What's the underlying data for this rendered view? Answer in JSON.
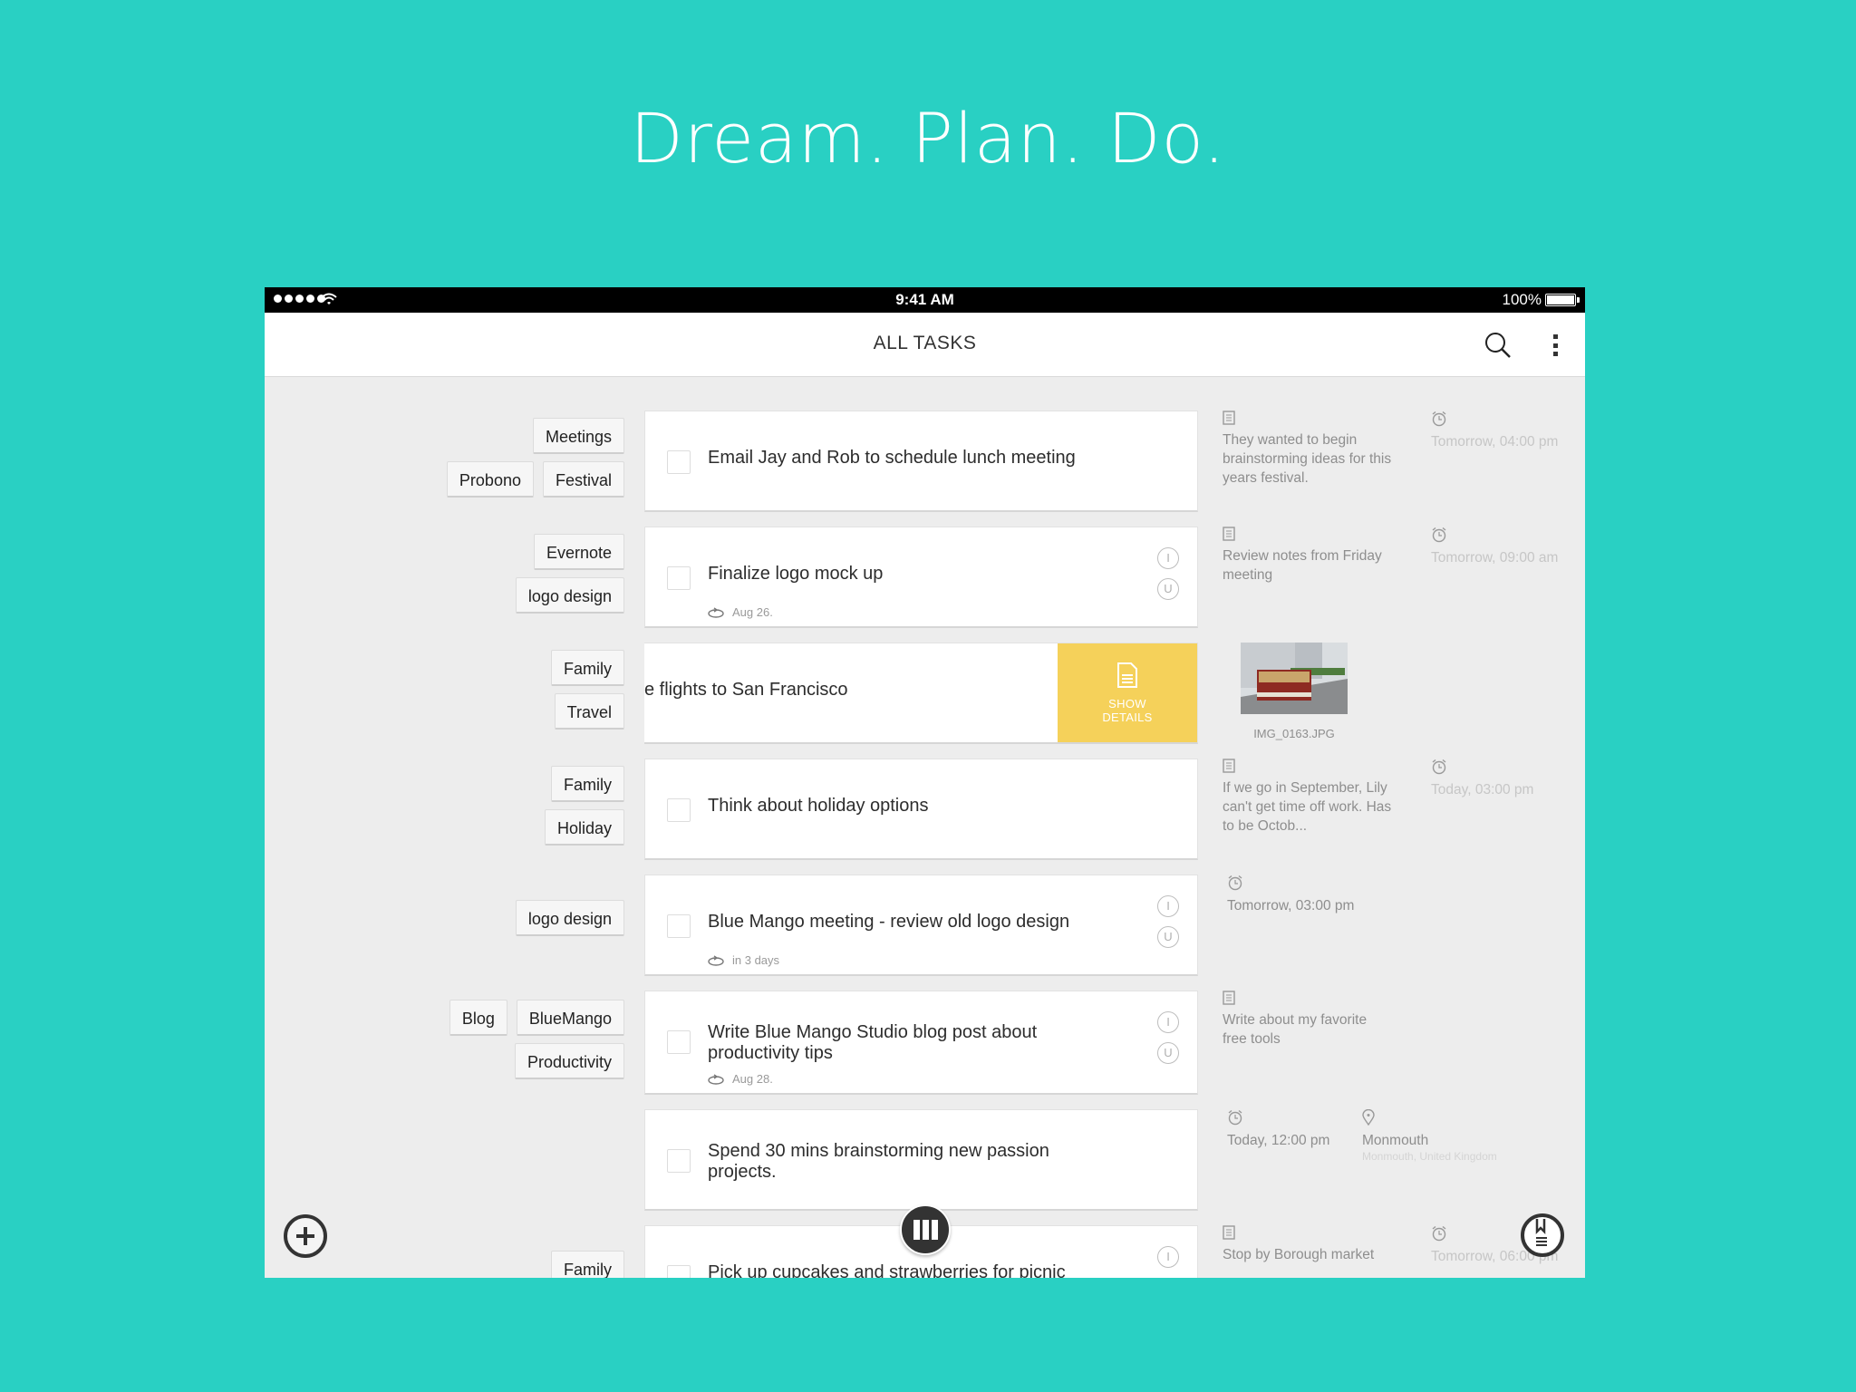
{
  "headline": "Dream. Plan. Do.",
  "status_bar": {
    "time": "9:41 AM",
    "battery": "100%",
    "signal_icon": "signal-dots-icon",
    "wifi_icon": "wifi-icon",
    "battery_icon": "battery-icon"
  },
  "app_bar": {
    "title": "ALL TASKS",
    "search_icon": "search-icon",
    "menu_icon": "more-vertical-icon"
  },
  "colors": {
    "background": "#29D0C3",
    "swipe_action": "#F5D15A",
    "fab": "#333333"
  },
  "tasks": [
    {
      "title": "Email Jay and Rob to schedule lunch meeting",
      "tags": [
        [
          "Meetings"
        ],
        [
          "Probono",
          "Festival"
        ]
      ],
      "note": "They wanted to begin brainstorming ideas for this years festival.",
      "reminder": "Tomorrow, 04:00 pm"
    },
    {
      "title": "Finalize logo mock up",
      "tags": [
        [
          "Evernote"
        ],
        [
          "logo design"
        ]
      ],
      "repeat": "Aug 26.",
      "badges": [
        "I",
        "U"
      ],
      "note": "Review notes from Friday meeting",
      "reminder": "Tomorrow, 09:00 am"
    },
    {
      "title_partial": "e flights to San Francisco",
      "tags": [
        [
          "Family"
        ],
        [
          "Travel"
        ]
      ],
      "swipe_action": {
        "label_line1": "SHOW",
        "label_line2": "DETAILS",
        "icon": "document-icon"
      },
      "attachment": {
        "filename": "IMG_0163.JPG"
      }
    },
    {
      "title": "Think about holiday options",
      "tags": [
        [
          "Family"
        ],
        [
          "Holiday"
        ]
      ],
      "note": "If we go in September, Lily can't get time off work. Has to be Octob...",
      "reminder": "Today, 03:00 pm"
    },
    {
      "title": "Blue Mango meeting - review old logo design",
      "tags": [
        [
          "logo design"
        ]
      ],
      "repeat": "in 3 days",
      "badges": [
        "I",
        "U"
      ],
      "reminder": "Tomorrow, 03:00 pm"
    },
    {
      "title": "Write Blue Mango Studio blog post about productivity tips",
      "tags": [
        [
          "Blog",
          "BlueMango"
        ],
        [
          "Productivity"
        ]
      ],
      "repeat": "Aug 28.",
      "badges": [
        "I",
        "U"
      ],
      "note": "Write about my favorite free tools"
    },
    {
      "title": "Spend 30 mins brainstorming new passion projects.",
      "tags": [],
      "reminder": "Today, 12:00 pm",
      "location": {
        "name": "Monmouth",
        "address": "Monmouth, United Kingdom"
      }
    },
    {
      "title": "Pick up cupcakes and strawberries for picnic",
      "tags": [
        [
          "Family"
        ]
      ],
      "badges": [
        "I"
      ],
      "note": "Stop by Borough market",
      "reminder": "Tomorrow, 06:00 pm"
    }
  ],
  "fabs": {
    "add": "add-task-button",
    "columns": "columns-view-button",
    "notes": "notes-button"
  }
}
